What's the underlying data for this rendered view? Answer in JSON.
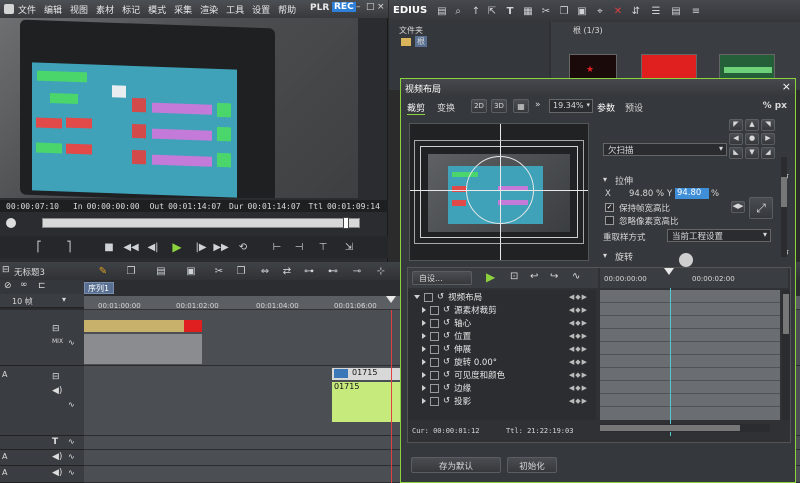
{
  "menu": {
    "items": [
      "文件",
      "编辑",
      "视图",
      "素材",
      "标记",
      "模式",
      "采集",
      "渲染",
      "工具",
      "设置",
      "帮助"
    ],
    "plr_label": "PLR",
    "rec_label": "REC"
  },
  "player": {
    "tc_current": "00:00:07:10",
    "in_label": "In",
    "in_value": "00:00:00:00",
    "out_label": "Out",
    "out_value": "00:01:14:07",
    "dur_label": "Dur",
    "dur_value": "00:01:14:07",
    "ttl_label": "Ttl",
    "ttl_value": "00:01:09:14"
  },
  "bin": {
    "app_name": "EDIUS",
    "folder_label": "文件夹",
    "root_label": "根",
    "count_label": "根 (1/3)"
  },
  "timeline": {
    "sequence_tab": "序列1",
    "project_name": "无标题3",
    "zoom_label": "10 帧",
    "ruler": [
      "00:01:00:00",
      "00:01:02:00",
      "00:01:04:00",
      "00:01:06:00"
    ],
    "clip_label_1": "01715",
    "clip_label_2": "01715",
    "mix_label": "MIX"
  },
  "dialog": {
    "title": "视频布局",
    "tab_crop": "裁剪",
    "tab_transform": "变换",
    "zoom_2d": "2D",
    "zoom_3d": "3D",
    "zoom_percent": "19.34%",
    "params_tab": "参数",
    "preset_tab": "预设",
    "pct_px": "% px",
    "underscan": "欠扫描",
    "stretch_section": "拉伸",
    "x_label": "X",
    "x_value": "94.80 %",
    "y_label": "Y",
    "y_value": "94.80",
    "pct_unit": "%",
    "keep_aspect": "保持帧宽高比",
    "ignore_pixel": "忽略像素宽高比",
    "resample_label": "重取样方式",
    "resample_value": "当前工程设置",
    "rotate_section": "旋转",
    "auto_label": "自设...",
    "tree": [
      {
        "label": "视频布局",
        "level": 0
      },
      {
        "label": "源素材裁剪",
        "level": 1
      },
      {
        "label": "轴心",
        "level": 1
      },
      {
        "label": "位置",
        "level": 1
      },
      {
        "label": "伸展",
        "level": 1
      },
      {
        "label": "旋转  0.00°",
        "level": 1
      },
      {
        "label": "可见度和颜色",
        "level": 1
      },
      {
        "label": "边缘",
        "level": 1
      },
      {
        "label": "投影",
        "level": 1
      }
    ],
    "kf_ruler_1": "00:00:00:00",
    "kf_ruler_2": "00:00:02:00",
    "cur_label": "Cur: 00:00:01:12",
    "ttl_label": "Ttl: 21:22:19:03",
    "save_default": "存为默认",
    "initialize": "初始化"
  },
  "colors": {
    "accent": "#8bd23c",
    "rec": "#2e7fd8",
    "playhead": "#e04040",
    "clip_yellow": "#c8b16a",
    "clip_green": "#c7ea7c"
  }
}
